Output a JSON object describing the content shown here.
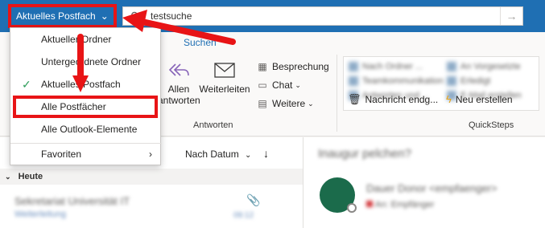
{
  "topbar": {
    "scope_label": "Aktuelles Postfach",
    "search_query": "testsuche"
  },
  "ribbon": {
    "search_tab": "Suchen",
    "reply_all_label": "Allen antworten",
    "reply_all_top": "Allen",
    "reply_all_bottom": "antworten",
    "forward_label": "Weiterleiten",
    "meeting_label": "Besprechung",
    "chat_label": "Chat",
    "more_label": "Weitere",
    "group_respond": "Antworten",
    "group_quicksteps": "QuickSteps",
    "quicksteps": [
      "Nachricht endg...",
      "Neu erstellen"
    ],
    "qs_blurred": [
      "Nach Ordner ...",
      "An Vorgesetzte",
      "Teamkommunikation",
      "Erledigt",
      "Antworten und ...",
      "E-Mail erstellen"
    ]
  },
  "menu": {
    "items": [
      {
        "label": "Aktueller Ordner",
        "checked": false
      },
      {
        "label": "Untergeordnete Ordner",
        "checked": false
      },
      {
        "label": "Aktuelles Postfach",
        "checked": true
      },
      {
        "label": "Alle Postfächer",
        "checked": false
      },
      {
        "label": "Alle Outlook-Elemente",
        "checked": false
      },
      {
        "label": "Favoriten",
        "checked": false
      }
    ]
  },
  "list": {
    "sort_label": "Nach Datum",
    "group_heading": "Heute",
    "mail": {
      "sender": "Sekretariat Universität IT",
      "subject": "Weiterleitung",
      "time": "09:12"
    }
  },
  "reading": {
    "subject": "Inaugur pelchen?",
    "from": "Dauer Donor <empfaenger>",
    "to": "An: Empfänger"
  },
  "colors": {
    "topbar": "#1f6fb3",
    "annotation_red": "#e81416",
    "check_green": "#2e9d5a",
    "avatar_green": "#1b6b4b"
  }
}
